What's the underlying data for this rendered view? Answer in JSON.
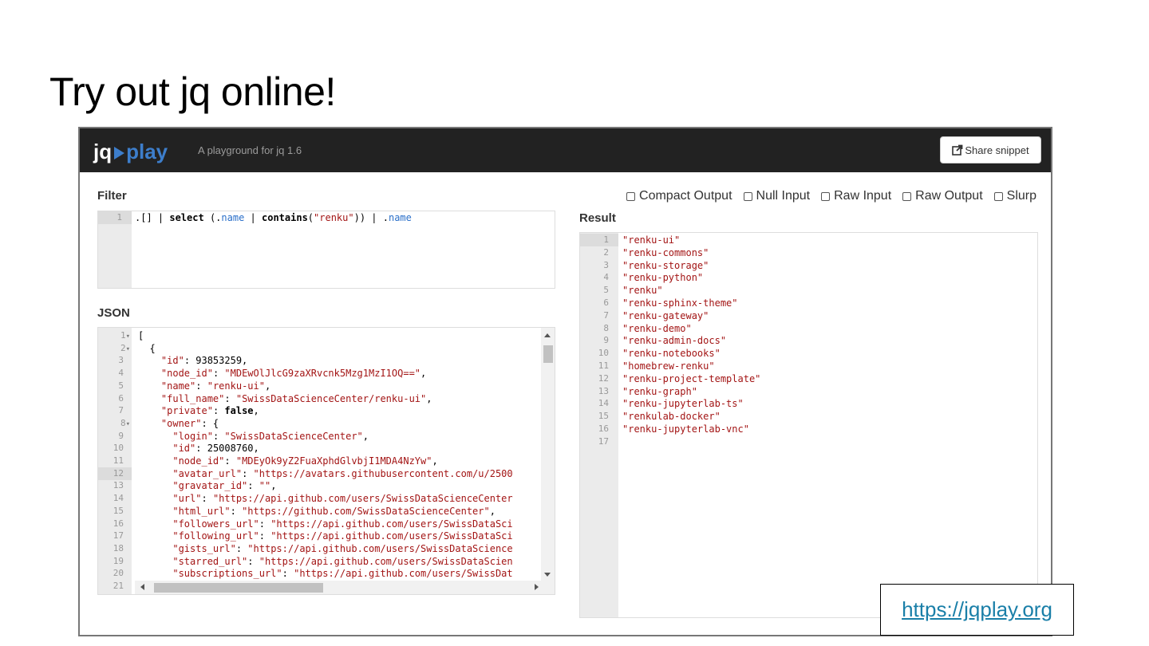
{
  "slide": {
    "title": "Try out jq online!",
    "link_label": "https://jqplay.org"
  },
  "app": {
    "brand_jq": "jq",
    "brand_play": "play",
    "tagline": "A playground for jq 1.6",
    "share_label": "Share snippet"
  },
  "filter": {
    "label": "Filter",
    "line_numbers": [
      "1"
    ],
    "code": ".[] | select (.name | contains(\"renku\")) | .name"
  },
  "options": [
    {
      "label": "Compact Output",
      "checked": false
    },
    {
      "label": "Null Input",
      "checked": false
    },
    {
      "label": "Raw Input",
      "checked": false
    },
    {
      "label": "Raw Output",
      "checked": false
    },
    {
      "label": "Slurp",
      "checked": false
    }
  ],
  "json": {
    "label": "JSON",
    "active_line": 12,
    "lines": [
      {
        "n": "1",
        "fold": true,
        "text": "["
      },
      {
        "n": "2",
        "fold": true,
        "text": "  {"
      },
      {
        "n": "3",
        "text": "    \"id\": 93853259,"
      },
      {
        "n": "4",
        "text": "    \"node_id\": \"MDEwOlJlcG9zaXRvcnk5Mzg1MzI1OQ==\","
      },
      {
        "n": "5",
        "text": "    \"name\": \"renku-ui\","
      },
      {
        "n": "6",
        "text": "    \"full_name\": \"SwissDataScienceCenter/renku-ui\","
      },
      {
        "n": "7",
        "text": "    \"private\": false,"
      },
      {
        "n": "8",
        "fold": true,
        "text": "    \"owner\": {"
      },
      {
        "n": "9",
        "text": "      \"login\": \"SwissDataScienceCenter\","
      },
      {
        "n": "10",
        "text": "      \"id\": 25008760,"
      },
      {
        "n": "11",
        "text": "      \"node_id\": \"MDEyOk9yZ2FuaXphdGlvbjI1MDA4NzYw\","
      },
      {
        "n": "12",
        "text": "      \"avatar_url\": \"https://avatars.githubusercontent.com/u/2500"
      },
      {
        "n": "13",
        "text": "      \"gravatar_id\": \"\","
      },
      {
        "n": "14",
        "text": "      \"url\": \"https://api.github.com/users/SwissDataScienceCenter"
      },
      {
        "n": "15",
        "text": "      \"html_url\": \"https://github.com/SwissDataScienceCenter\","
      },
      {
        "n": "16",
        "text": "      \"followers_url\": \"https://api.github.com/users/SwissDataSci"
      },
      {
        "n": "17",
        "text": "      \"following_url\": \"https://api.github.com/users/SwissDataSci"
      },
      {
        "n": "18",
        "text": "      \"gists_url\": \"https://api.github.com/users/SwissDataScience"
      },
      {
        "n": "19",
        "text": "      \"starred_url\": \"https://api.github.com/users/SwissDataScien"
      },
      {
        "n": "20",
        "text": "      \"subscriptions_url\": \"https://api.github.com/users/SwissDat"
      },
      {
        "n": "21",
        "text": ""
      }
    ]
  },
  "result": {
    "label": "Result",
    "lines": [
      {
        "n": "1",
        "text": "\"renku-ui\""
      },
      {
        "n": "2",
        "text": "\"renku-commons\""
      },
      {
        "n": "3",
        "text": "\"renku-storage\""
      },
      {
        "n": "4",
        "text": "\"renku-python\""
      },
      {
        "n": "5",
        "text": "\"renku\""
      },
      {
        "n": "6",
        "text": "\"renku-sphinx-theme\""
      },
      {
        "n": "7",
        "text": "\"renku-gateway\""
      },
      {
        "n": "8",
        "text": "\"renku-demo\""
      },
      {
        "n": "9",
        "text": "\"renku-admin-docs\""
      },
      {
        "n": "10",
        "text": "\"renku-notebooks\""
      },
      {
        "n": "11",
        "text": "\"homebrew-renku\""
      },
      {
        "n": "12",
        "text": "\"renku-project-template\""
      },
      {
        "n": "13",
        "text": "\"renku-graph\""
      },
      {
        "n": "14",
        "text": "\"renku-jupyterlab-ts\""
      },
      {
        "n": "15",
        "text": "\"renkulab-docker\""
      },
      {
        "n": "16",
        "text": "\"renku-jupyterlab-vnc\""
      },
      {
        "n": "17",
        "text": ""
      }
    ]
  },
  "colors": {
    "navbar": "#222222",
    "brand_accent": "#3d7ecb",
    "string": "#a31515",
    "field": "#2a6fc9",
    "link": "#1a7fa8"
  }
}
